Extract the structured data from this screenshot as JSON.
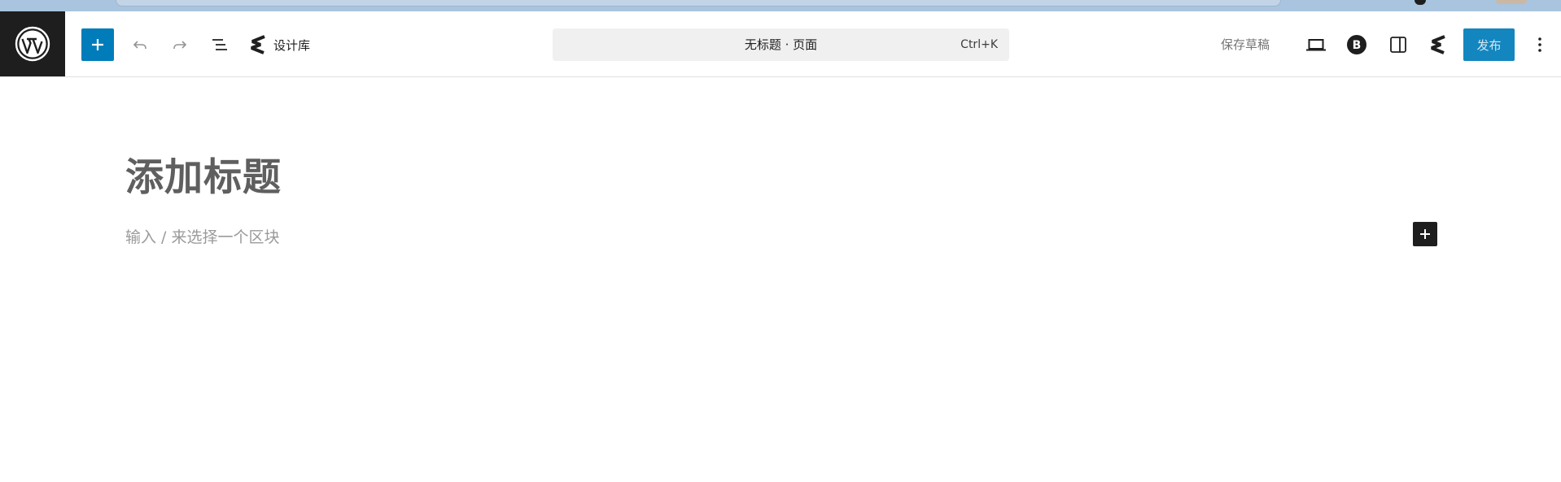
{
  "header": {
    "patterns_label": "设计库",
    "command_title": "无标题 · 页面",
    "command_shortcut": "Ctrl+K",
    "save_draft_label": "保存草稿",
    "publish_label": "发布"
  },
  "icons": {
    "logo": "wordpress-logo-icon",
    "inserter": "plus-icon",
    "undo": "undo-icon",
    "redo": "redo-icon",
    "outline": "list-view-icon",
    "patterns": "spectra-icon",
    "preview": "laptop-icon",
    "b_extension": "b-circle-icon",
    "settings": "sidebar-toggle-icon",
    "spectra": "spectra-icon",
    "more": "more-vertical-icon"
  },
  "colors": {
    "accent": "#007cba",
    "dark": "#1e1e1e",
    "title_text": "#5f5f5f",
    "placeholder_text": "#9a9a9a"
  },
  "canvas": {
    "title_placeholder": "添加标题",
    "block_placeholder": "输入 / 来选择一个区块"
  }
}
